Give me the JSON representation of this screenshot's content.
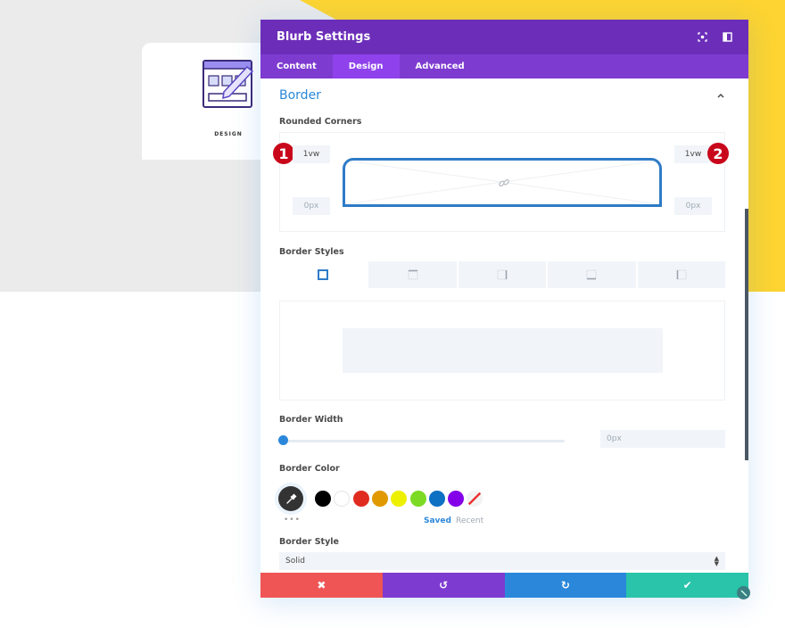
{
  "background": {
    "blurb": {
      "title": "DESIGN",
      "icon": "design-window-pencil-icon"
    }
  },
  "modal": {
    "title": "Blurb Settings",
    "header_icons": [
      "focus-mode-icon",
      "sidebar-toggle-icon"
    ],
    "tabs": [
      {
        "label": "Content",
        "active": false
      },
      {
        "label": "Design",
        "active": true
      },
      {
        "label": "Advanced",
        "active": false
      }
    ],
    "section": {
      "title": "Border",
      "expanded": true,
      "rounded_corners": {
        "label": "Rounded Corners",
        "top_left": "1vw",
        "top_right": "1vw",
        "bottom_left_placeholder": "0px",
        "bottom_right_placeholder": "0px",
        "annotations": [
          "1",
          "2"
        ],
        "link_icon": "link-icon"
      },
      "border_styles": {
        "label": "Border Styles",
        "options": [
          "all-sides",
          "top",
          "right",
          "bottom",
          "left"
        ],
        "active_index": 0
      },
      "border_width": {
        "label": "Border Width",
        "value": 0,
        "placeholder": "0px"
      },
      "border_color": {
        "label": "Border Color",
        "swatches": [
          "#000000",
          "#ffffff",
          "#e02b20",
          "#e09900",
          "#edf000",
          "#7cda24",
          "#0c71c3",
          "#8300e9",
          "transparent"
        ],
        "more": "•••",
        "tabs": [
          {
            "label": "Saved",
            "active": true
          },
          {
            "label": "Recent",
            "active": false
          }
        ]
      },
      "border_style": {
        "label": "Border Style",
        "value": "Solid"
      }
    },
    "footer": [
      {
        "name": "cancel",
        "symbol": "✖",
        "color": "#ef5555"
      },
      {
        "name": "undo",
        "symbol": "↺",
        "color": "#7e3bd0"
      },
      {
        "name": "redo",
        "symbol": "↻",
        "color": "#2b87da"
      },
      {
        "name": "save",
        "symbol": "✔",
        "color": "#29c4a9"
      }
    ]
  }
}
